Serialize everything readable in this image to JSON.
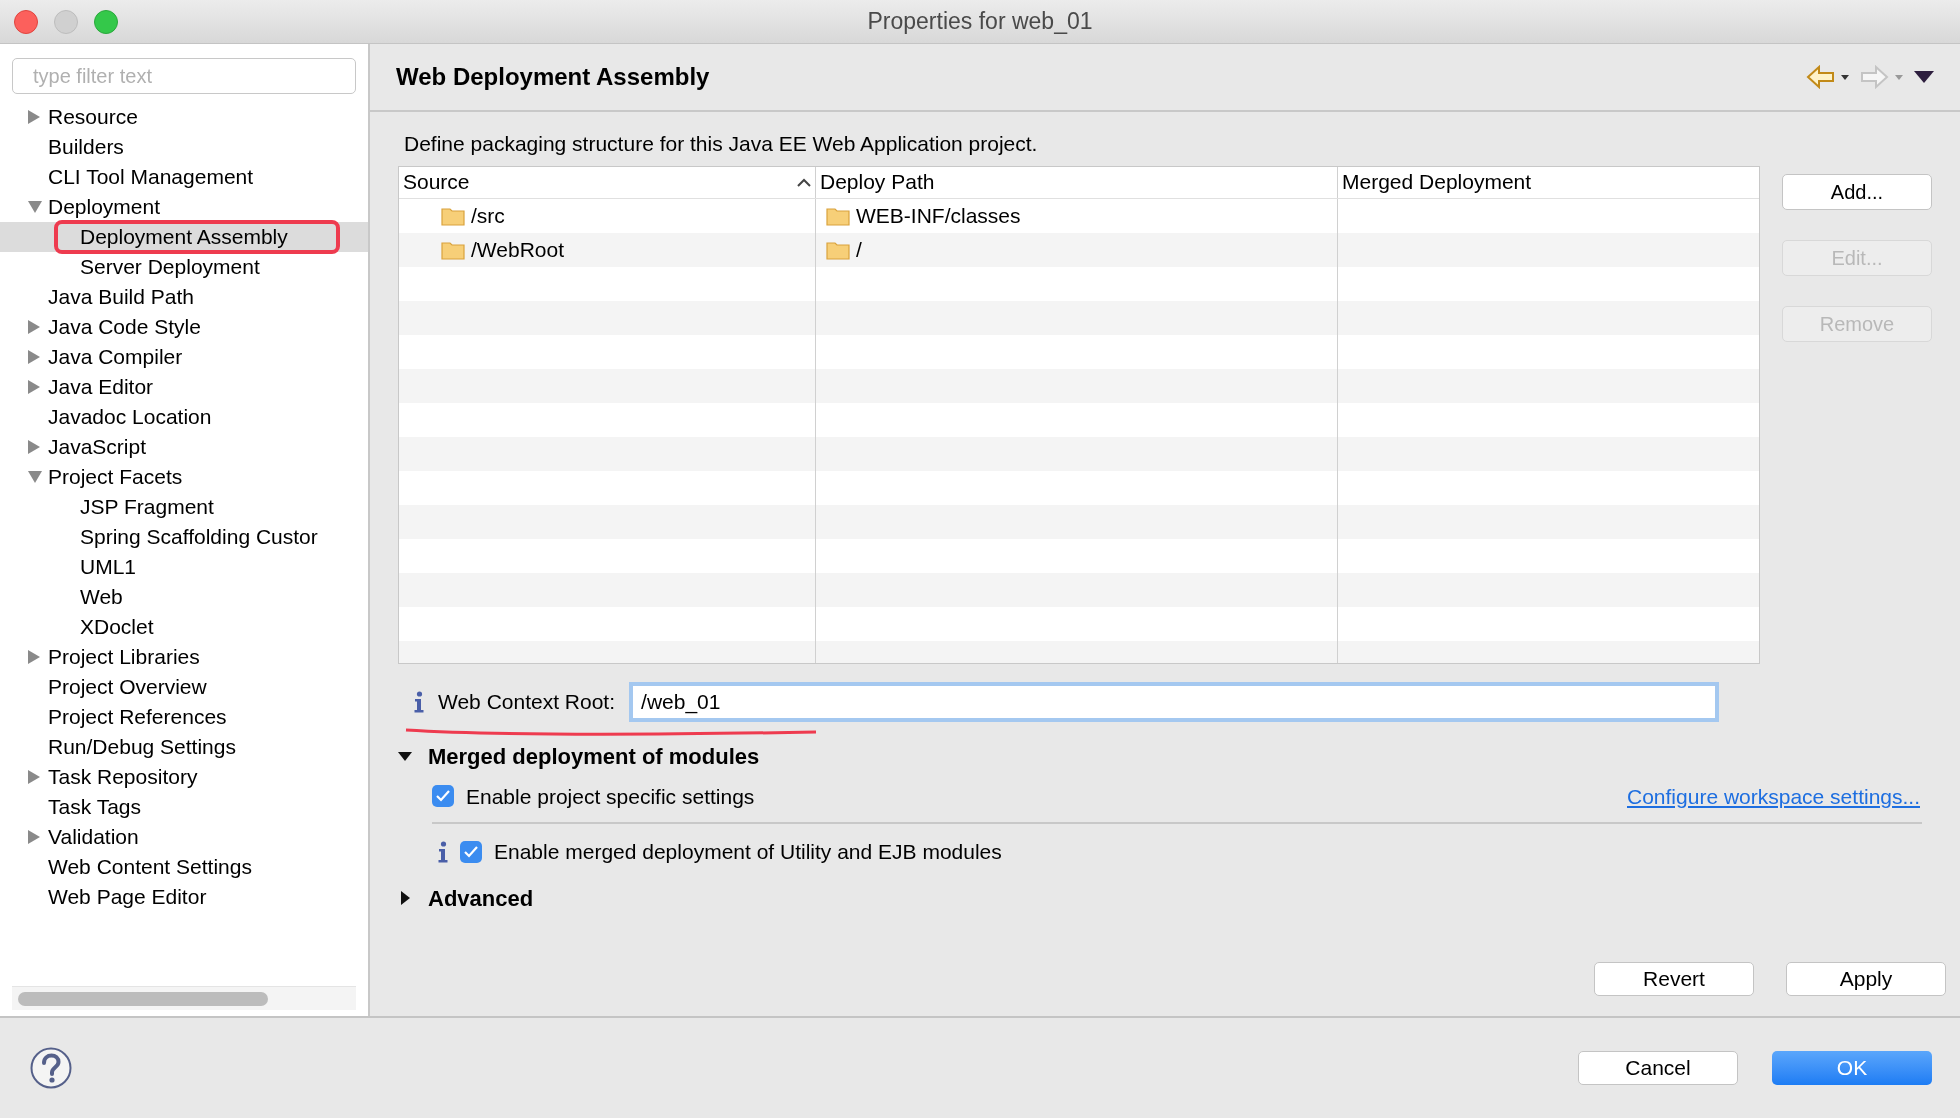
{
  "window": {
    "title": "Properties for web_01"
  },
  "filter": {
    "placeholder": "type filter text"
  },
  "tree": [
    {
      "label": "Resource",
      "expanded": false,
      "selected": false
    },
    {
      "label": "Builders",
      "selected": false
    },
    {
      "label": "CLI Tool Management",
      "selected": false
    },
    {
      "label": "Deployment",
      "expanded": true,
      "selected": false,
      "children": [
        {
          "label": "Deployment Assembly",
          "selected": true
        },
        {
          "label": "Server Deployment",
          "selected": false
        }
      ]
    },
    {
      "label": "Java Build Path",
      "selected": false
    },
    {
      "label": "Java Code Style",
      "expanded": false,
      "selected": false
    },
    {
      "label": "Java Compiler",
      "expanded": false,
      "selected": false
    },
    {
      "label": "Java Editor",
      "expanded": false,
      "selected": false
    },
    {
      "label": "Javadoc Location",
      "selected": false
    },
    {
      "label": "JavaScript",
      "expanded": false,
      "selected": false
    },
    {
      "label": "Project Facets",
      "expanded": true,
      "selected": false,
      "children": [
        {
          "label": "JSP Fragment",
          "selected": false
        },
        {
          "label": "Spring Scaffolding Custor",
          "selected": false
        },
        {
          "label": "UML1",
          "selected": false
        },
        {
          "label": "Web",
          "selected": false
        },
        {
          "label": "XDoclet",
          "selected": false
        }
      ]
    },
    {
      "label": "Project Libraries",
      "expanded": false,
      "selected": false
    },
    {
      "label": "Project Overview",
      "selected": false
    },
    {
      "label": "Project References",
      "selected": false
    },
    {
      "label": "Run/Debug Settings",
      "selected": false
    },
    {
      "label": "Task Repository",
      "expanded": false,
      "selected": false
    },
    {
      "label": "Task Tags",
      "selected": false
    },
    {
      "label": "Validation",
      "expanded": false,
      "selected": false
    },
    {
      "label": "Web Content Settings",
      "selected": false
    },
    {
      "label": "Web Page Editor",
      "selected": false
    }
  ],
  "page": {
    "title": "Web Deployment Assembly",
    "description": "Define packaging structure for this Java EE Web Application project."
  },
  "table": {
    "columns": [
      "Source",
      "Deploy Path",
      "Merged Deployment"
    ],
    "rows": [
      {
        "source": "/src",
        "deploy_path": "WEB-INF/classes"
      },
      {
        "source": "/WebRoot",
        "deploy_path": "/"
      }
    ]
  },
  "side_buttons": [
    {
      "label": "Add...",
      "disabled": false
    },
    {
      "label": "Edit...",
      "disabled": true
    },
    {
      "label": "Remove",
      "disabled": true
    }
  ],
  "context_root": {
    "label": "Web Context Root:",
    "value": "/web_01"
  },
  "sections": [
    {
      "title": "Merged deployment of modules",
      "expanded": true
    },
    {
      "title": "Advanced",
      "expanded": false
    }
  ],
  "project_setting": {
    "label": "Enable project specific settings",
    "checked": true,
    "link": "Configure workspace settings..."
  },
  "merged_option": {
    "label": "Enable merged deployment of Utility and EJB modules",
    "checked": true
  },
  "page_buttons": [
    "Revert",
    "Apply"
  ],
  "dialog_buttons": [
    {
      "label": "Cancel",
      "kind": "plain"
    },
    {
      "label": "OK",
      "kind": "default"
    }
  ]
}
